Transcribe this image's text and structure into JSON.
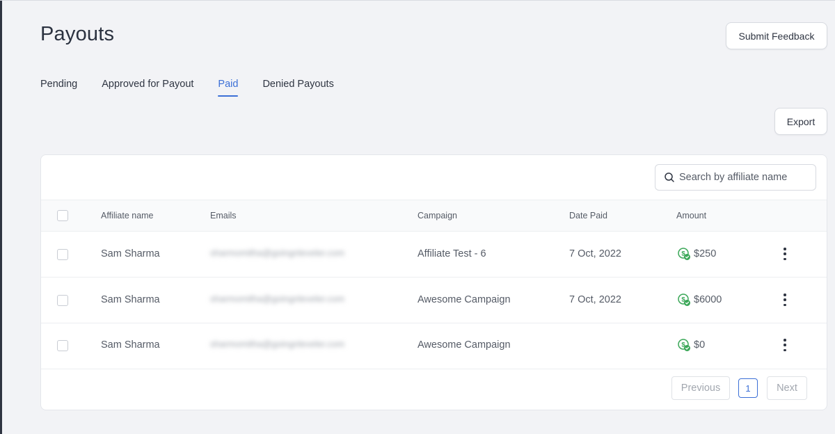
{
  "page": {
    "title": "Payouts"
  },
  "actions": {
    "feedback_label": "Submit Feedback",
    "export_label": "Export"
  },
  "tabs": [
    {
      "label": "Pending",
      "active": false
    },
    {
      "label": "Approved for Payout",
      "active": false
    },
    {
      "label": "Paid",
      "active": true
    },
    {
      "label": "Denied Payouts",
      "active": false
    }
  ],
  "search": {
    "placeholder": "Search by affiliate name",
    "value": ""
  },
  "table": {
    "columns": [
      "Affiliate name",
      "Emails",
      "Campaign",
      "Date Paid",
      "Amount"
    ],
    "rows": [
      {
        "affiliate": "Sam Sharma",
        "email": "sharmomitha@goingnleveler.com",
        "campaign": "Affiliate Test - 6",
        "date_paid": "7 Oct, 2022",
        "amount": "$250"
      },
      {
        "affiliate": "Sam Sharma",
        "email": "sharmomitha@goingnleveler.com",
        "campaign": "Awesome Campaign",
        "date_paid": "7 Oct, 2022",
        "amount": "$6000"
      },
      {
        "affiliate": "Sam Sharma",
        "email": "sharmomitha@goingnleveler.com",
        "campaign": "Awesome Campaign",
        "date_paid": "",
        "amount": "$0"
      }
    ]
  },
  "pagination": {
    "previous_label": "Previous",
    "current_page": "1",
    "next_label": "Next"
  },
  "colors": {
    "accent": "#3b6fd6",
    "paid_icon": "#3aa757"
  }
}
